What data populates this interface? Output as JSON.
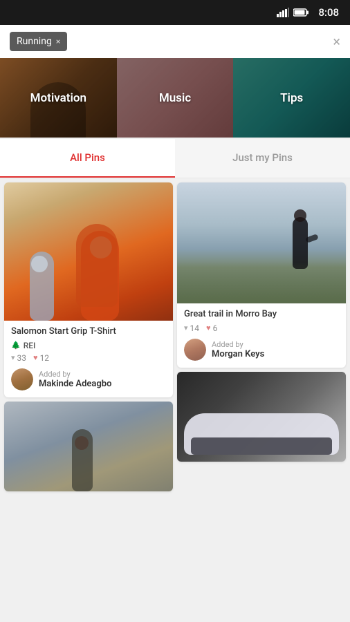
{
  "statusBar": {
    "time": "8:08"
  },
  "searchBar": {
    "tagLabel": "Running",
    "tagCloseIcon": "×",
    "clearIcon": "×"
  },
  "categories": [
    {
      "id": "motivation",
      "label": "Motivation"
    },
    {
      "id": "music",
      "label": "Music"
    },
    {
      "id": "tips",
      "label": "Tips"
    }
  ],
  "tabs": [
    {
      "id": "all-pins",
      "label": "All Pins",
      "active": true
    },
    {
      "id": "just-my-pins",
      "label": "Just my Pins",
      "active": false
    }
  ],
  "leftColumn": {
    "pins": [
      {
        "id": "pin-1",
        "title": "Salomon Start Grip T-Shirt",
        "source": "REI",
        "stats": {
          "pins": "33",
          "hearts": "12"
        },
        "addedByLabel": "Added by",
        "authorName": "Makinde Adeagbo"
      }
    ]
  },
  "rightColumn": {
    "pins": [
      {
        "id": "pin-2",
        "title": "Great trail in Morro Bay",
        "stats": {
          "pins": "14",
          "hearts": "6"
        },
        "addedByLabel": "Added by",
        "authorName": "Morgan Keys"
      }
    ]
  },
  "icons": {
    "signal": "signal-icon",
    "battery": "battery-icon",
    "pin": "📌",
    "heart": "♥",
    "tree": "🌲",
    "tagClose": "×",
    "searchClear": "×"
  }
}
